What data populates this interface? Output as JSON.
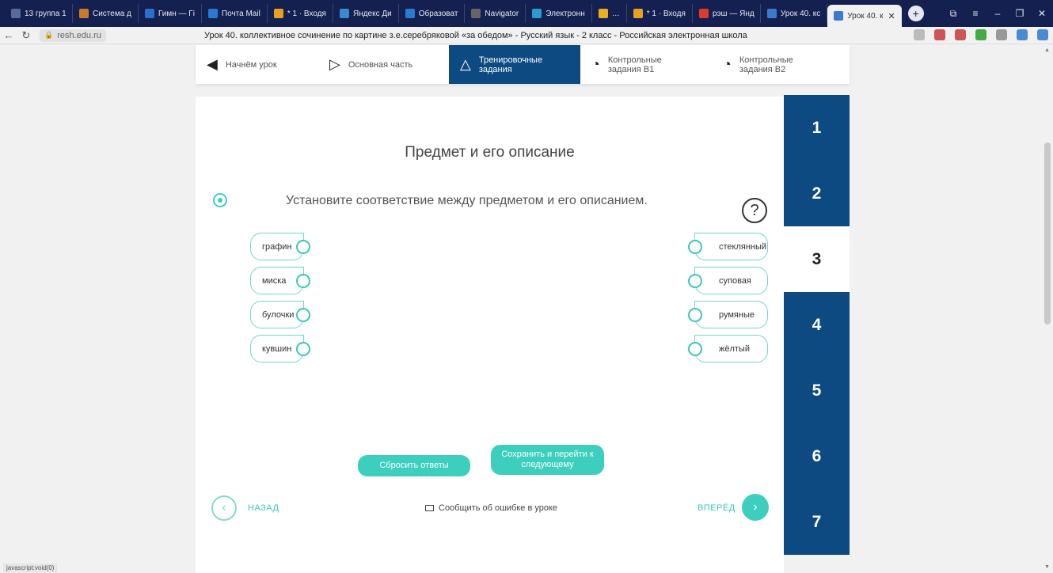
{
  "browser": {
    "tabs": [
      {
        "label": "13 группа 1",
        "color": "#5a6a9a"
      },
      {
        "label": "Система д",
        "color": "#c97a2a"
      },
      {
        "label": "Гимн — Гі",
        "color": "#2a6ecf"
      },
      {
        "label": "Почта Mail",
        "color": "#2a7acf"
      },
      {
        "label": "* 1 · Входя",
        "color": "#e8a020"
      },
      {
        "label": "Яндекс Ди",
        "color": "#3a8ad0"
      },
      {
        "label": "Образоват",
        "color": "#2a7acf"
      },
      {
        "label": "Navigator",
        "color": "#666666"
      },
      {
        "label": "Электронн",
        "color": "#2a9ad0"
      },
      {
        "label": "…",
        "color": "#e8b020"
      },
      {
        "label": "* 1 · Входя",
        "color": "#e8a020"
      },
      {
        "label": "рэш — Янд",
        "color": "#e03a2a"
      },
      {
        "label": "Урок 40. кс",
        "color": "#3a7acf"
      }
    ],
    "active_tab": {
      "label": "Урок 40. к",
      "close": "✕"
    },
    "new_tab": "+",
    "window_controls": [
      "⧉",
      "≡",
      "–",
      "❐",
      "✕"
    ],
    "url": "resh.edu.ru",
    "page_title": "Урок 40. коллективное сочинение по картине з.е.серебряковой «за обедом» - Русский язык - 2 класс - Российская электронная школа",
    "status": "javascript:void(0)"
  },
  "lesson_nav": [
    {
      "label": "Начнём урок",
      "icon": "megaphone-icon",
      "glyph": "◀︎",
      "active": false
    },
    {
      "label": "Основная часть",
      "icon": "play-icon",
      "glyph": "▷",
      "active": false
    },
    {
      "label": "Тренировочные задания",
      "icon": "pyramid-icon",
      "glyph": "△",
      "active": true
    },
    {
      "label": "Контрольные задания В1",
      "icon": "stopwatch-icon",
      "glyph": "◔",
      "active": false
    },
    {
      "label": "Контрольные задания В2",
      "icon": "stopwatch-icon",
      "glyph": "◔",
      "active": false
    }
  ],
  "task": {
    "title": "Предмет и его описание",
    "instruction": "Установите соответствие между предметом и его описанием.",
    "help": "?",
    "left_items": [
      "графин",
      "миска",
      "булочки",
      "кувшин"
    ],
    "right_items": [
      "стеклянный",
      "суповая",
      "румяные",
      "жёлтый"
    ],
    "reset_label": "Сбросить ответы",
    "save_label": "Сохранить и перейти к следующему",
    "back_label": "НАЗАД",
    "forward_label": "ВПЕРЁД",
    "report_label": "Сообщить об ошибке в уроке",
    "accent": "#3dcfbd"
  },
  "steps": [
    "1",
    "2",
    "3",
    "4",
    "5",
    "6",
    "7"
  ],
  "active_step": "3",
  "brand_color": "#0e4a82"
}
